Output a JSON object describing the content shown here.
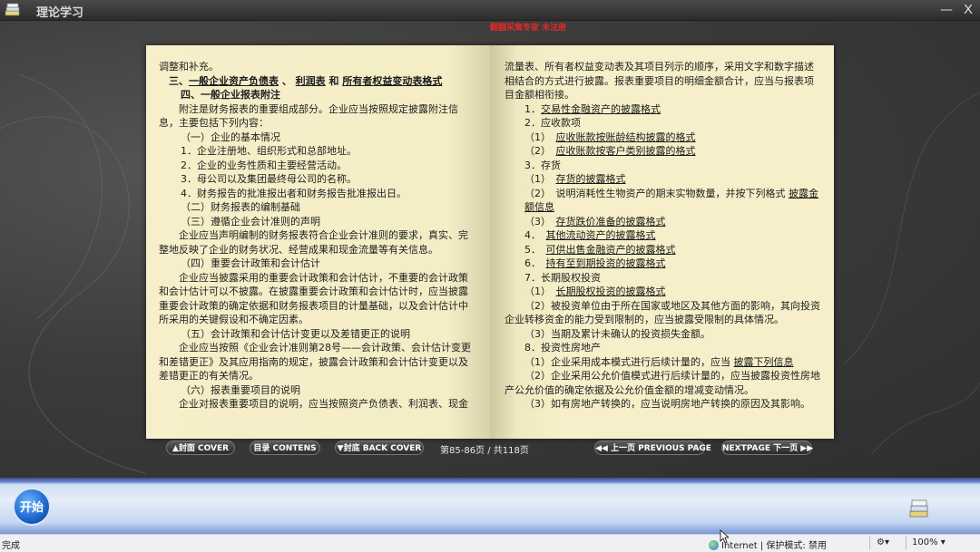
{
  "window": {
    "title": "理论学习",
    "minimize": "—",
    "close": "X",
    "unregistered": "翻翻采集专家 未注册"
  },
  "left_page": [
    {
      "text": "调整和补充。",
      "cls": ""
    },
    {
      "html_parts": [
        "　三、",
        "一般企业资产负债表",
        " 、 ",
        "利润表",
        " 和 ",
        "所有者权益变动表格式"
      ],
      "cls": "bold"
    },
    {
      "text": "四、一般企业报表附注",
      "cls": "ind2 bold"
    },
    {
      "text": "附注是财务报表的重要组成部分。企业应当按照规定披露附注信息，主要包括下列内容：",
      "cls": "ind1"
    },
    {
      "text": "（一）企业的基本情况",
      "cls": "ind2"
    },
    {
      "text": "1．企业注册地、组织形式和总部地址。",
      "cls": "ind2"
    },
    {
      "text": "2．企业的业务性质和主要经营活动。",
      "cls": "ind2"
    },
    {
      "text": "3．母公司以及集团最终母公司的名称。",
      "cls": "ind2"
    },
    {
      "text": "4．财务报告的批准报出者和财务报告批准报出日。",
      "cls": "ind2"
    },
    {
      "text": "（二）财务报表的编制基础",
      "cls": "ind2"
    },
    {
      "text": "（三）遵循企业会计准则的声明",
      "cls": "ind2"
    },
    {
      "text": "企业应当声明编制的财务报表符合企业会计准则的要求，真实、完整地反映了企业的财务状况、经营成果和现金流量等有关信息。",
      "cls": "ind1"
    },
    {
      "text": "（四）重要会计政策和会计估计",
      "cls": "ind2"
    },
    {
      "text": "企业应当披露采用的重要会计政策和会计估计，不重要的会计政策和会计估计可以不披露。在披露重要会计政策和会计估计时，应当披露重要会计政策的确定依据和财务报表项目的计量基础，以及会计估计中所采用的关键假设和不确定因素。",
      "cls": "ind1"
    },
    {
      "text": "（五）会计政策和会计估计变更以及差错更正的说明",
      "cls": "ind2"
    },
    {
      "text": "企业应当按照《企业会计准则第28号——会计政策、会计估计变更和差错更正》及其应用指南的规定，披露会计政策和会计估计变更以及差错更正的有关情况。",
      "cls": "ind1"
    },
    {
      "text": "（六）报表重要项目的说明",
      "cls": "ind2"
    },
    {
      "text": "企业对报表重要项目的说明，应当按照资产负债表、利润表、现金",
      "cls": "ind1"
    }
  ],
  "right_page": [
    {
      "text": "流量表、所有者权益变动表及其项目列示的顺序，采用文字和数字描述相结合的方式进行披露。报表重要项目的明细金额合计，应当与报表项目金额相衔接。",
      "cls": ""
    },
    {
      "pre": "1．",
      "link": "交易性金融资产的披露格式",
      "cls": "ind4"
    },
    {
      "text": "2．应收款项",
      "cls": "ind4"
    },
    {
      "pre": "（1）　",
      "link": "应收账款按账龄结构披露的格式",
      "cls": "ind4"
    },
    {
      "pre": "（2）　",
      "link": "应收账款按客户类别披露的格式",
      "cls": "ind4"
    },
    {
      "text": "3．存货",
      "cls": "ind4"
    },
    {
      "pre": "（1）　",
      "link": "存货的披露格式",
      "cls": "ind4"
    },
    {
      "pre": "（2）　说明消耗性生物资产的期末实物数量，并按下列格式 ",
      "link": "披露金额信息",
      "cls": "ind4"
    },
    {
      "pre": "（3）　",
      "link": "存货跌价准备的披露格式",
      "cls": "ind4"
    },
    {
      "pre": "4．　",
      "link": "其他流动资产的披露格式",
      "cls": "ind4"
    },
    {
      "pre": "5．　",
      "link": "可供出售金融资产的披露格式",
      "cls": "ind4"
    },
    {
      "pre": "6．　",
      "link": "持有至到期投资的披露格式",
      "cls": "ind4"
    },
    {
      "text": "7．长期股权投资",
      "cls": "ind4"
    },
    {
      "pre": "（1）　",
      "link": "长期股权投资的披露格式",
      "cls": "ind4"
    },
    {
      "text": "（2）被投资单位由于所在国家或地区及其他方面的影响，其向投资企业转移资金的能力受到限制的，应当披露受限制的具体情况。",
      "cls": "ind1"
    },
    {
      "text": "（3）当期及累计未确认的投资损失金额。",
      "cls": "ind4"
    },
    {
      "text": "8．投资性房地产",
      "cls": "ind4"
    },
    {
      "pre": "（1）企业采用成本模式进行后续计量的，应当 ",
      "link": "披露下列信息",
      "cls": "ind4"
    },
    {
      "text": "（2）企业采用公允价值模式进行后续计量的，应当披露投资性房地产公允价值的确定依据及公允价值金额的增减变动情况。",
      "cls": "ind1"
    },
    {
      "text": "（3）如有房地产转换的，应当说明房地产转换的原因及其影响。",
      "cls": "ind4"
    }
  ],
  "toolbar": {
    "cover": "▲封面 COVER",
    "contents": "目录 CONTENS",
    "back_cover": "▼封底 BACK COVER",
    "page_info": "第85-86页 / 共118页",
    "prev": "◀◀ 上一页 PREVIOUS PAGE",
    "next": "NEXTPAGE 下一页 ▶▶"
  },
  "taskbar": {
    "start": "开始"
  },
  "statusbar": {
    "status": "完成",
    "zone": "Internet | 保护模式: 禁用",
    "zoom": "100%",
    "zoom_arrow": "▾",
    "gear": "⚙▾"
  },
  "colors": {
    "page_bg": "#f6efc9",
    "unregistered_red": "#e02a2a",
    "start_blue": "#1f6bd1"
  }
}
